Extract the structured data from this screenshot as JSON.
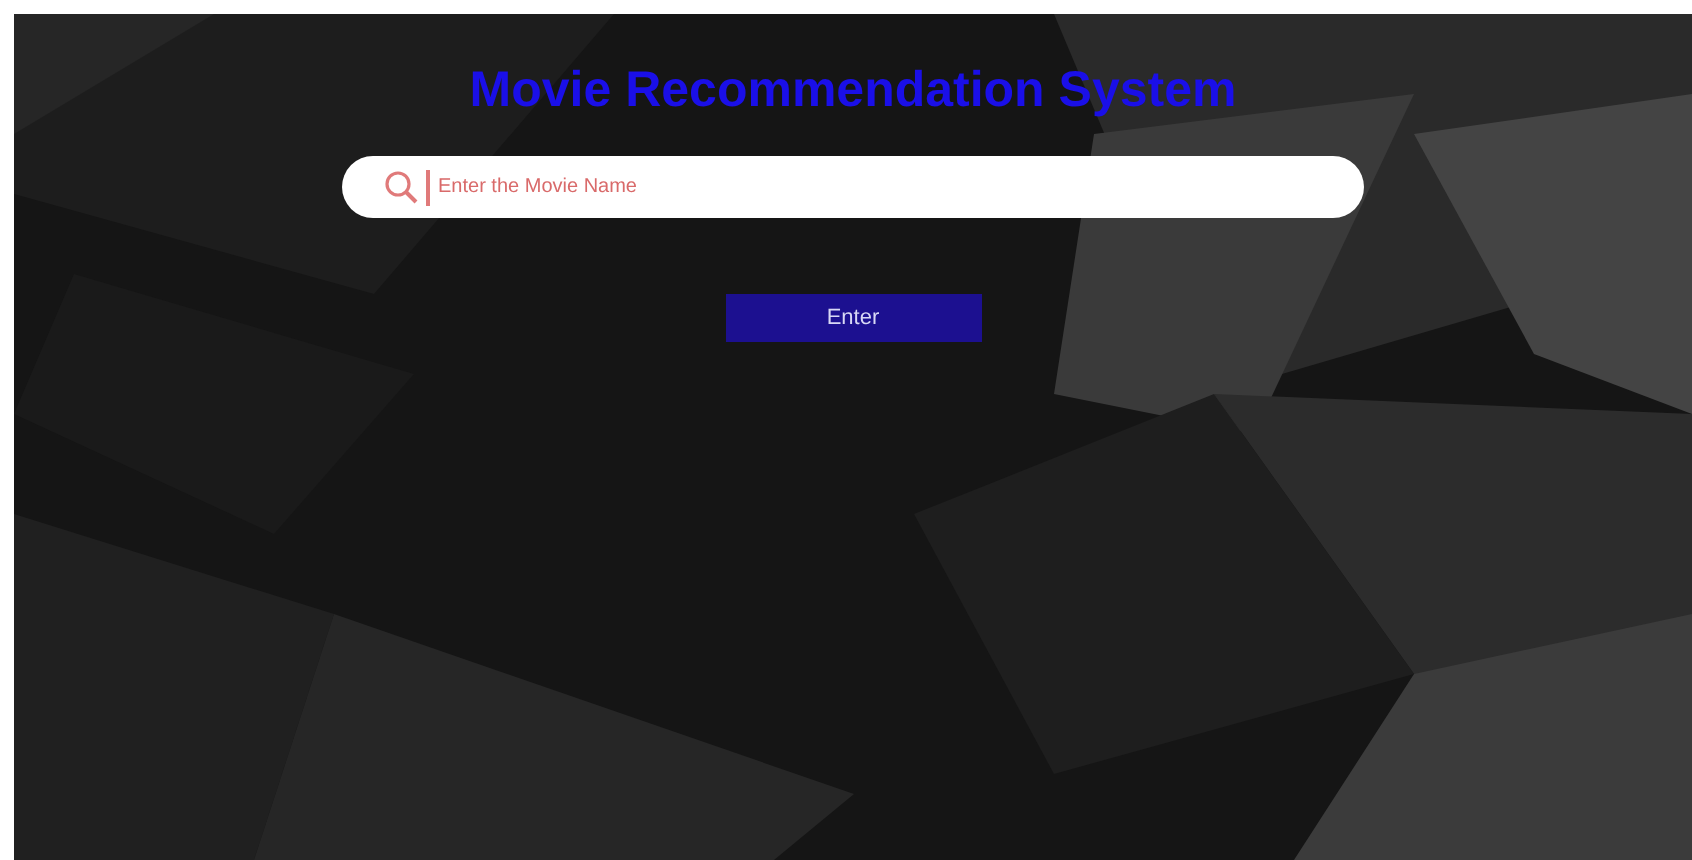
{
  "title": "Movie Recommendation System",
  "search": {
    "placeholder": "Enter the Movie Name"
  },
  "button": {
    "label": "Enter"
  }
}
